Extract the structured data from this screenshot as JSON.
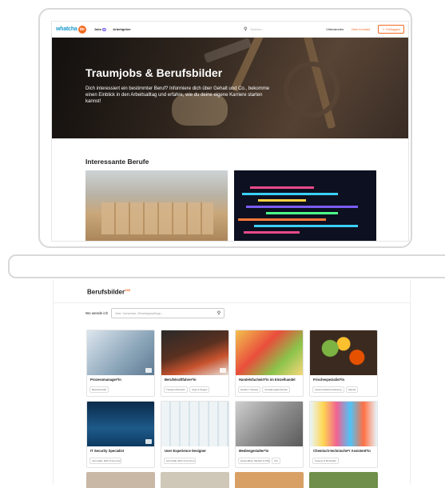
{
  "header": {
    "logo_text": "whatcha",
    "logo_do": "do",
    "nav": [
      {
        "label": "Jobs",
        "badge": "20"
      },
      {
        "label": "Arbeitgeber"
      }
    ],
    "search_placeholder": "Suchen...",
    "right_links": [
      "Videostories",
      "Dein Kontakt"
    ],
    "login_label": "Einloggen"
  },
  "hero": {
    "title": "Traumjobs & Berufsbilder",
    "text": "Dich interessiert ein bestimmter Beruf? Informiere dich über Gehalt und Co., bekomme einen Einblick in den Arbeitsalltag und erfahre, wie du deine eigene Karriere starten kannst!"
  },
  "interesting": {
    "title": "Interessante Berufe"
  },
  "berufsbilder": {
    "title": "Berufsbilder",
    "count": "338",
    "search_label": "Wo wende ich",
    "search_placeholder": "Amt, Vorschau, Einsteigerpflege..."
  },
  "tiles": [
    {
      "title": "Prozessmanager*in",
      "tags": [
        "Bauwirtschaft"
      ]
    },
    {
      "title": "Berufskraftfahrer*in",
      "tags": [
        "Transport/Verkehr",
        "ringe & Kluges"
      ]
    },
    {
      "title": "Handelsfachwirt*in im Einzelhandel",
      "tags": [
        "Handel / Verkauf",
        "Verwaltungsbehörden"
      ]
    },
    {
      "title": "Frischespezialist*in",
      "tags": [
        "Lebensmittelverarbeitung",
        "Handel"
      ]
    },
    {
      "title": "IT Security Specialist",
      "tags": [
        "Informatik, EDV & Kommunikationstechnik"
      ]
    },
    {
      "title": "User Experience Designer",
      "tags": [
        "informatik, EDV & Kommunikationstechnik"
      ]
    },
    {
      "title": "Mediengestalter*in",
      "tags": [
        "Gesundheit, Medizin & Pflege",
        "info"
      ]
    },
    {
      "title": "Chemisch-technische*r Assistent*in",
      "tags": [
        "Chemie & Rohstoffe"
      ]
    }
  ],
  "colors": {
    "accent": "#f26a21",
    "logo_blue": "#1b9acb"
  }
}
